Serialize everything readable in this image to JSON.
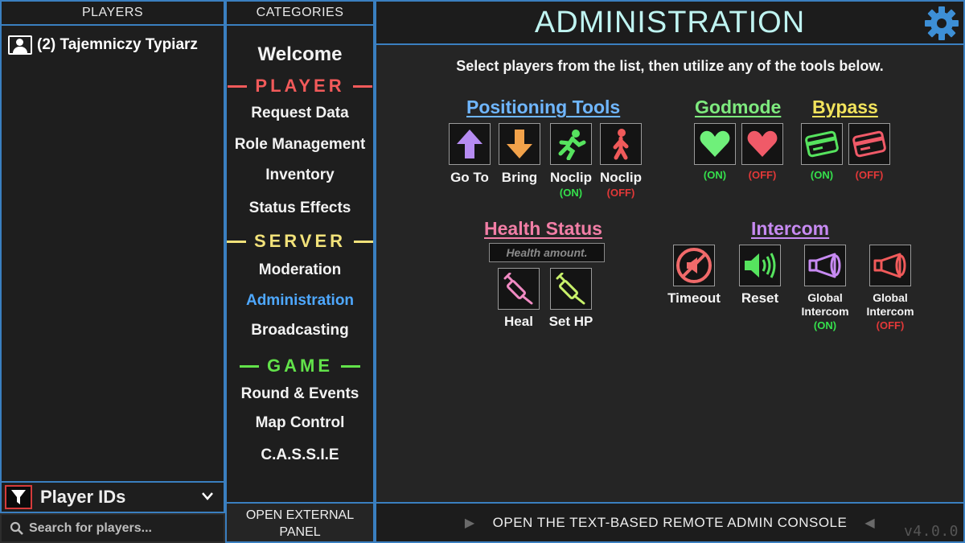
{
  "players_panel": {
    "header": "PLAYERS",
    "players": [
      {
        "label": "(2) Tajemniczy Typiarz"
      }
    ],
    "filter_label": "Player IDs",
    "search_placeholder": "Search for players..."
  },
  "categories_panel": {
    "header": "CATEGORIES",
    "welcome": "Welcome",
    "sections": {
      "player": {
        "title": "PLAYER",
        "color": "#f25a5a",
        "items": [
          "Request Data",
          "Role Management",
          "Inventory",
          "Status Effects"
        ]
      },
      "server": {
        "title": "SERVER",
        "color": "#f2e27a",
        "items": [
          "Moderation",
          "Administration",
          "Broadcasting"
        ]
      },
      "game": {
        "title": "GAME",
        "color": "#62e24a",
        "items": [
          "Round & Events",
          "Map Control",
          "C.A.S.S.I.E"
        ]
      }
    },
    "active_item": "Administration",
    "open_external": [
      "OPEN EXTERNAL",
      "PANEL"
    ]
  },
  "main": {
    "title": "ADMINISTRATION",
    "instructions": "Select players from the list, then utilize any of the tools below.",
    "groups": {
      "positioning": {
        "title": "Positioning Tools",
        "color": "#6fb6ff",
        "tools": [
          {
            "label": "Go To",
            "icon": "arrow-up-icon"
          },
          {
            "label": "Bring",
            "icon": "arrow-down-icon"
          },
          {
            "label": "Noclip",
            "status": "(ON)",
            "icon": "running-person-icon"
          },
          {
            "label": "Noclip",
            "status": "(OFF)",
            "icon": "walking-person-icon"
          }
        ]
      },
      "godmode": {
        "title": "Godmode",
        "color": "#7eea7e",
        "on": "(ON)",
        "off": "(OFF)"
      },
      "bypass": {
        "title": "Bypass",
        "color": "#f2e35c",
        "on": "(ON)",
        "off": "(OFF)"
      },
      "health": {
        "title": "Health Status",
        "color": "#f27ea6",
        "placeholder": "Health amount.",
        "tools": [
          {
            "label": "Heal",
            "icon": "syringe-icon"
          },
          {
            "label": "Set HP",
            "icon": "syringe-icon"
          }
        ]
      },
      "intercom": {
        "title": "Intercom",
        "color": "#c78af2",
        "tools": [
          {
            "label": "Timeout",
            "icon": "mute-icon"
          },
          {
            "label": "Reset",
            "icon": "speaker-icon"
          },
          {
            "label": "Global Intercom",
            "status": "(ON)",
            "icon": "megaphone-icon"
          },
          {
            "label": "Global Intercom",
            "status": "(OFF)",
            "icon": "megaphone-icon"
          }
        ]
      }
    }
  },
  "console_bar": {
    "label": "OPEN THE TEXT-BASED REMOTE ADMIN CONSOLE",
    "version": "v4.0.0"
  },
  "colors": {
    "border": "#3a7fc0",
    "active": "#4ea8ff",
    "on": "#35e04c",
    "off": "#e23838"
  }
}
